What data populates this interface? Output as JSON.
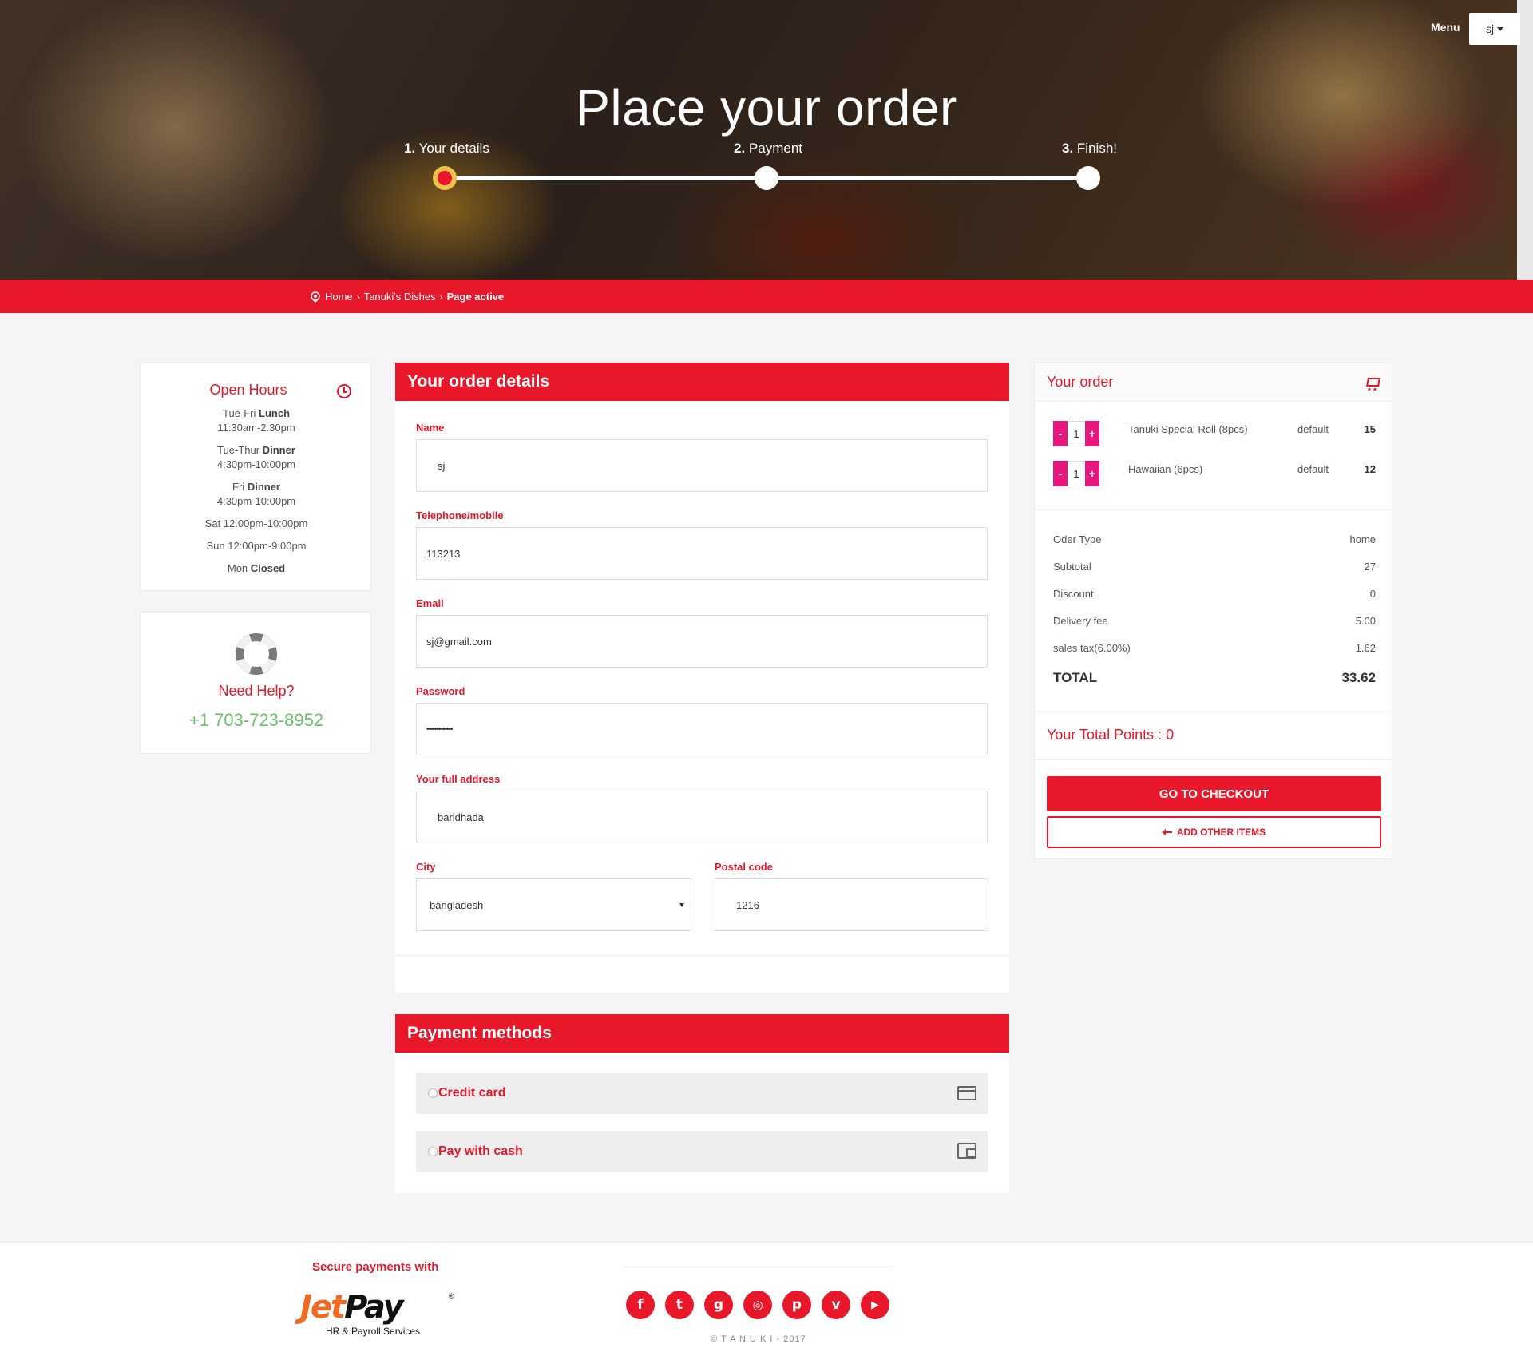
{
  "header": {
    "title": "Place your order",
    "menu_label": "Menu",
    "user_label": "sj",
    "steps": [
      {
        "num": "1.",
        "label": "Your details"
      },
      {
        "num": "2.",
        "label": "Payment"
      },
      {
        "num": "3.",
        "label": "Finish!"
      }
    ]
  },
  "breadcrumb": {
    "items": [
      "Home",
      "Tanuki's Dishes"
    ],
    "separator": "›",
    "active": "Page active"
  },
  "open_hours": {
    "title": "Open Hours",
    "rows": [
      {
        "day": "Tue-Fri",
        "meal": "Lunch",
        "time": "11:30am-2.30pm"
      },
      {
        "day": "Tue-Thur",
        "meal": "Dinner",
        "time": "4:30pm-10:00pm"
      },
      {
        "day": "Fri",
        "meal": "Dinner",
        "time": "4:30pm-10:00pm"
      },
      {
        "text": "Sat 12.00pm-10:00pm"
      },
      {
        "text": "Sun 12:00pm-9:00pm"
      },
      {
        "day": "Mon",
        "status": "Closed"
      }
    ]
  },
  "help": {
    "title": "Need Help?",
    "phone": "+1 703-723-8952"
  },
  "order_details": {
    "title": "Your order details",
    "fields": {
      "name": {
        "label": "Name",
        "value": "sj"
      },
      "telephone": {
        "label": "Telephone/mobile",
        "value": "113213"
      },
      "email": {
        "label": "Email",
        "value": "sj@gmail.com"
      },
      "password": {
        "label": "Password",
        "value": "•••••••••••••"
      },
      "address": {
        "label": "Your full address",
        "value": "baridhada"
      },
      "city": {
        "label": "City",
        "value": "bangladesh"
      },
      "postal": {
        "label": "Postal code",
        "value": "1216"
      }
    }
  },
  "payment": {
    "title": "Payment methods",
    "methods": [
      {
        "label": "Credit card",
        "icon": "credit-card-icon"
      },
      {
        "label": "Pay with cash",
        "icon": "wallet-icon"
      }
    ]
  },
  "order": {
    "title": "Your order",
    "items": [
      {
        "qty": "1",
        "name": "Tanuki Special Roll (8pcs)",
        "option": "default",
        "price": "15"
      },
      {
        "qty": "1",
        "name": "Hawaiian (6pcs)",
        "option": "default",
        "price": "12"
      }
    ],
    "minus": "-",
    "plus": "+",
    "summary": [
      {
        "label": "Oder Type",
        "value": "home"
      },
      {
        "label": "Subtotal",
        "value": "27"
      },
      {
        "label": "Discount",
        "value": "0"
      },
      {
        "label": "Delivery fee",
        "value": "5.00"
      },
      {
        "label": "sales tax(6.00%)",
        "value": "1.62"
      }
    ],
    "total_label": "TOTAL",
    "total_value": "33.62",
    "points": "Your Total Points : 0",
    "checkout_label": "GO TO CHECKOUT",
    "add_items_label": "ADD OTHER ITEMS"
  },
  "footer": {
    "secure_label": "Secure payments with",
    "logo_jet": "Jet",
    "logo_pay": "Pay",
    "logo_reg": "®",
    "logo_tagline": "HR & Payroll Services",
    "socials": [
      {
        "name": "facebook-icon",
        "glyph": "f"
      },
      {
        "name": "twitter-icon",
        "glyph": "t"
      },
      {
        "name": "google-plus-icon",
        "glyph": "g"
      },
      {
        "name": "instagram-icon",
        "glyph": "◎"
      },
      {
        "name": "pinterest-icon",
        "glyph": "p"
      },
      {
        "name": "vimeo-icon",
        "glyph": "v"
      },
      {
        "name": "youtube-icon",
        "glyph": "▶"
      }
    ],
    "copyright": "© T A N U K I - 2017"
  },
  "colors": {
    "brand_red": "#e8172a",
    "stepper_pink": "#e8177f",
    "phone_green": "#6dbf6d",
    "step_active_ring": "#f2c14b"
  }
}
